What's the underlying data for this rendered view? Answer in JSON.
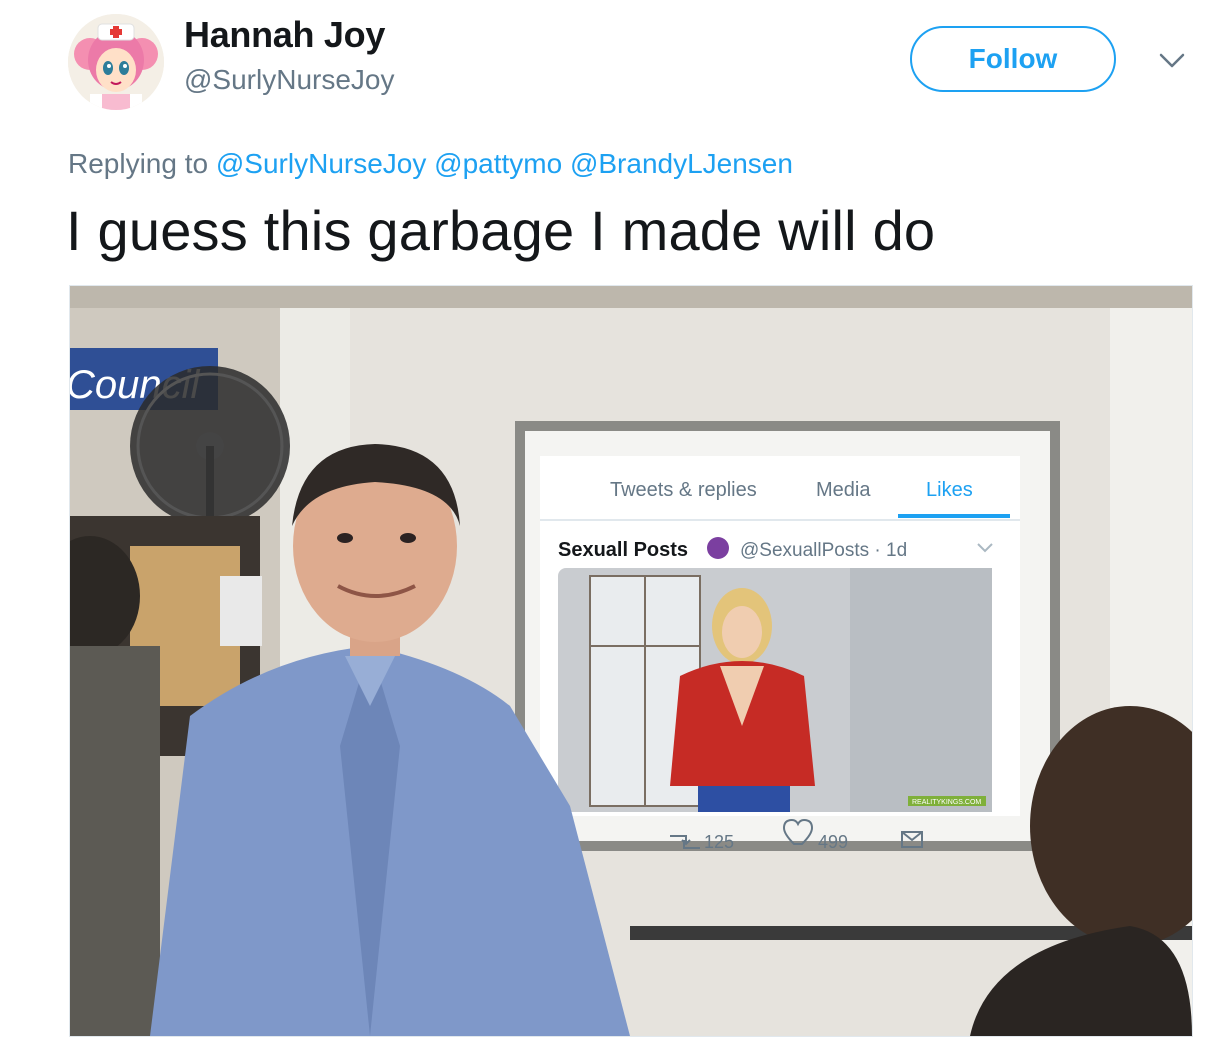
{
  "user": {
    "display_name": "Hannah Joy",
    "handle": "@SurlyNurseJoy",
    "avatar_icon": "cartoon-nurse-avatar"
  },
  "header": {
    "follow_label": "Follow",
    "caret_icon": "chevron-down-icon"
  },
  "reply": {
    "prefix": "Replying to",
    "mentions": [
      "@SurlyNurseJoy",
      "@pattymo",
      "@BrandyLJensen"
    ]
  },
  "tweet": {
    "text": "I guess this garbage I made will do"
  },
  "media": {
    "sign_text": "Council",
    "embedded_tweet": {
      "tabs": [
        "Tweets & replies",
        "Media",
        "Likes"
      ],
      "active_tab": "Likes",
      "author_name": "Sexuall Posts",
      "author_meta": "@SexuallPosts · 1d",
      "retweet_count": "125",
      "like_count": "499",
      "watermark": "REALITYKINGS.COM"
    }
  },
  "colors": {
    "accent": "#1da1f2",
    "secondary_text": "#657786",
    "primary_text": "#14171a"
  }
}
